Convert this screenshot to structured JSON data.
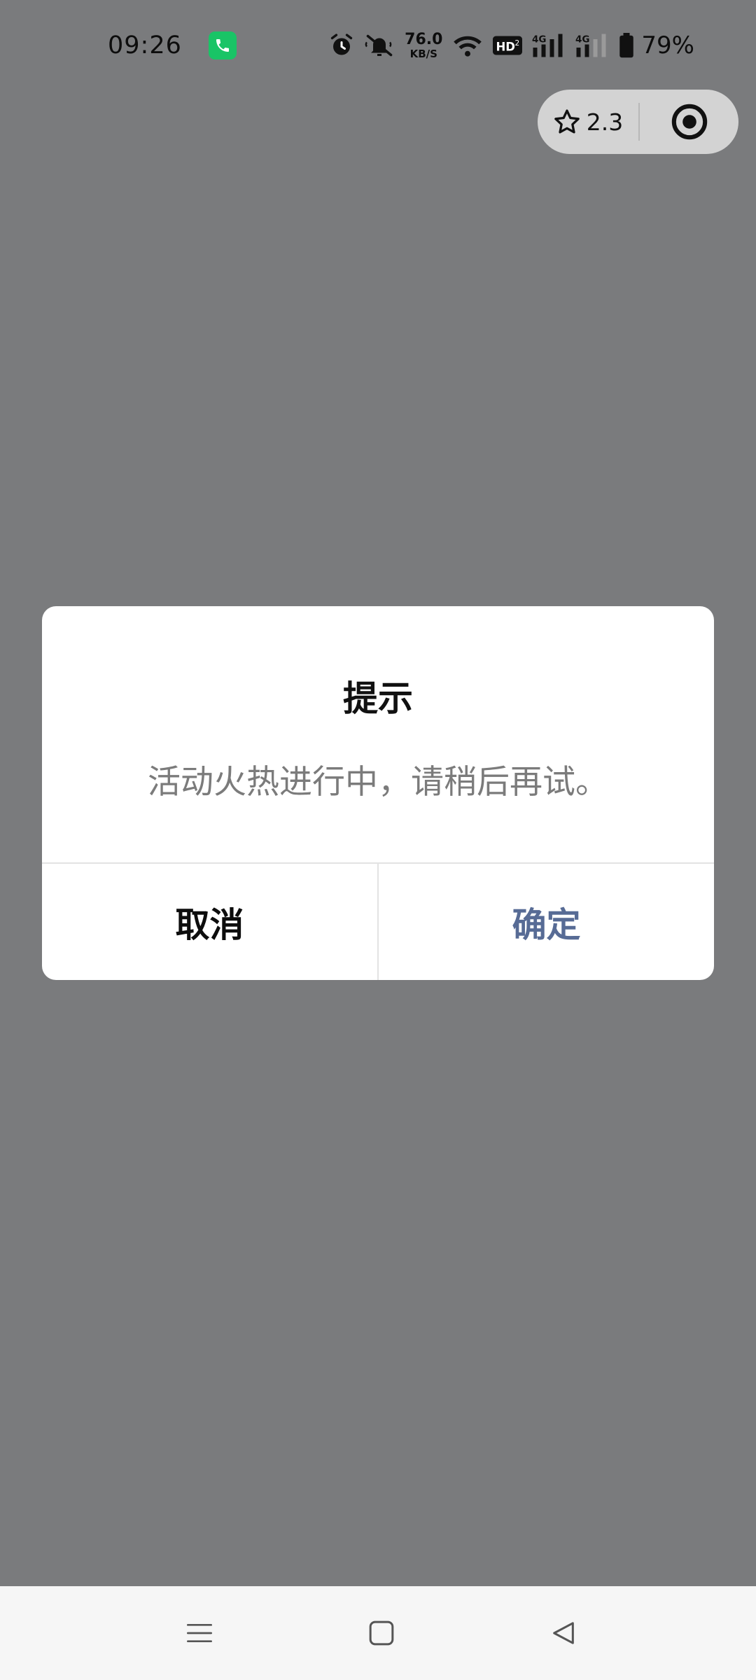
{
  "status_bar": {
    "time": "09:26",
    "net_speed_value": "76.0",
    "net_speed_unit": "KB/S",
    "battery_percent": "79%",
    "icons": [
      "phone-call-icon",
      "alarm-icon",
      "mute-bell-icon",
      "wifi-icon",
      "hd-icon",
      "4g-signal-icon",
      "4g-signal-icon",
      "battery-icon"
    ]
  },
  "capsule": {
    "score": "2.3",
    "icons": [
      "star-icon",
      "target-icon"
    ]
  },
  "dialog": {
    "title": "提示",
    "message": "活动火热进行中，请稍后再试。",
    "cancel_label": "取消",
    "confirm_label": "确定"
  },
  "nav_bar": {
    "icons": [
      "menu-icon",
      "home-icon",
      "back-icon"
    ]
  },
  "colors": {
    "overlay": "#7a7b7d",
    "confirm": "#576b95",
    "call_badge": "#19c466"
  }
}
